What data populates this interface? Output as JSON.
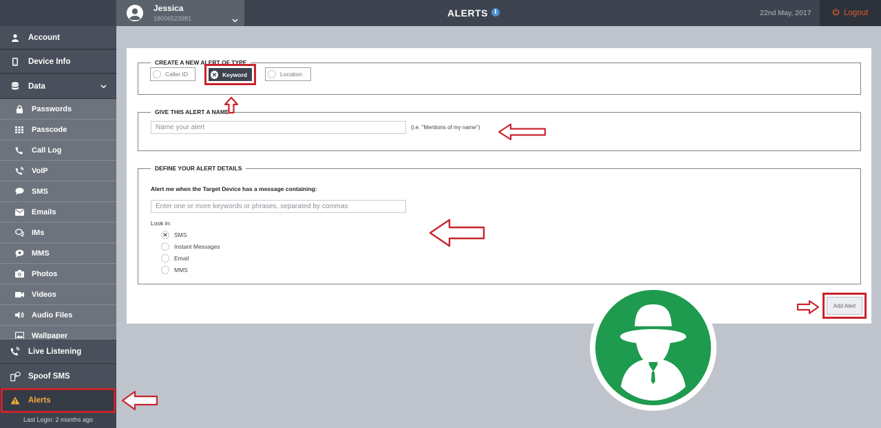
{
  "header": {
    "user_name": "Jessica",
    "user_phone": "18006523981",
    "title": "ALERTS",
    "info_glyph": "i",
    "date": "22nd May, 2017",
    "logout_label": "Logout"
  },
  "sidebar": {
    "main_items": [
      {
        "label": "Account",
        "icon": "user-icon"
      },
      {
        "label": "Device Info",
        "icon": "phone-icon"
      },
      {
        "label": "Data",
        "icon": "database-icon"
      }
    ],
    "sub_items": [
      {
        "label": "Passwords",
        "icon": "lock-icon"
      },
      {
        "label": "Passcode",
        "icon": "grid-icon"
      },
      {
        "label": "Call Log",
        "icon": "call-icon"
      },
      {
        "label": "VoIP",
        "icon": "voip-icon"
      },
      {
        "label": "SMS",
        "icon": "chat-icon"
      },
      {
        "label": "Emails",
        "icon": "mail-icon"
      },
      {
        "label": "IMs",
        "icon": "im-icon"
      },
      {
        "label": "MMS",
        "icon": "mms-icon"
      },
      {
        "label": "Photos",
        "icon": "camera-icon"
      },
      {
        "label": "Videos",
        "icon": "video-icon"
      },
      {
        "label": "Audio Files",
        "icon": "audio-icon"
      },
      {
        "label": "Wallpaper",
        "icon": "image-icon"
      }
    ],
    "bottom_items": [
      {
        "label": "Live Listening",
        "icon": "phone-wave-icon"
      },
      {
        "label": "Spoof SMS",
        "icon": "spoof-icon"
      },
      {
        "label": "Alerts",
        "icon": "warning-icon"
      }
    ],
    "footer": "Last Login: 2 months ago"
  },
  "form": {
    "type_legend": "CREATE A NEW ALERT OF TYPE",
    "types": [
      "Caller ID",
      "Keyword",
      "Location"
    ],
    "selected_type": "Keyword",
    "name_legend": "GIVE THIS ALERT A NAME",
    "name_placeholder": "Name your alert",
    "name_hint": "(i.e. \"Mentions of my name\")",
    "details_legend": "DEFINE YOUR ALERT DETAILS",
    "details_label": "Alert me when the Target Device has a message containing:",
    "keywords_placeholder": "Enter one or more keywords or phrases, separated by commas",
    "look_in_label": "Look in:",
    "look_in_options": [
      "SMS",
      "Instant Messages",
      "Email",
      "MMS"
    ],
    "look_in_selected": "SMS",
    "check_glyph": "✕",
    "add_label": "Add Alert"
  },
  "colors": {
    "accent_red": "#c8232c",
    "alert_orange": "#f0a93a",
    "logo_green": "#1e9b4e",
    "sidebar_dark": "#3d4450"
  }
}
